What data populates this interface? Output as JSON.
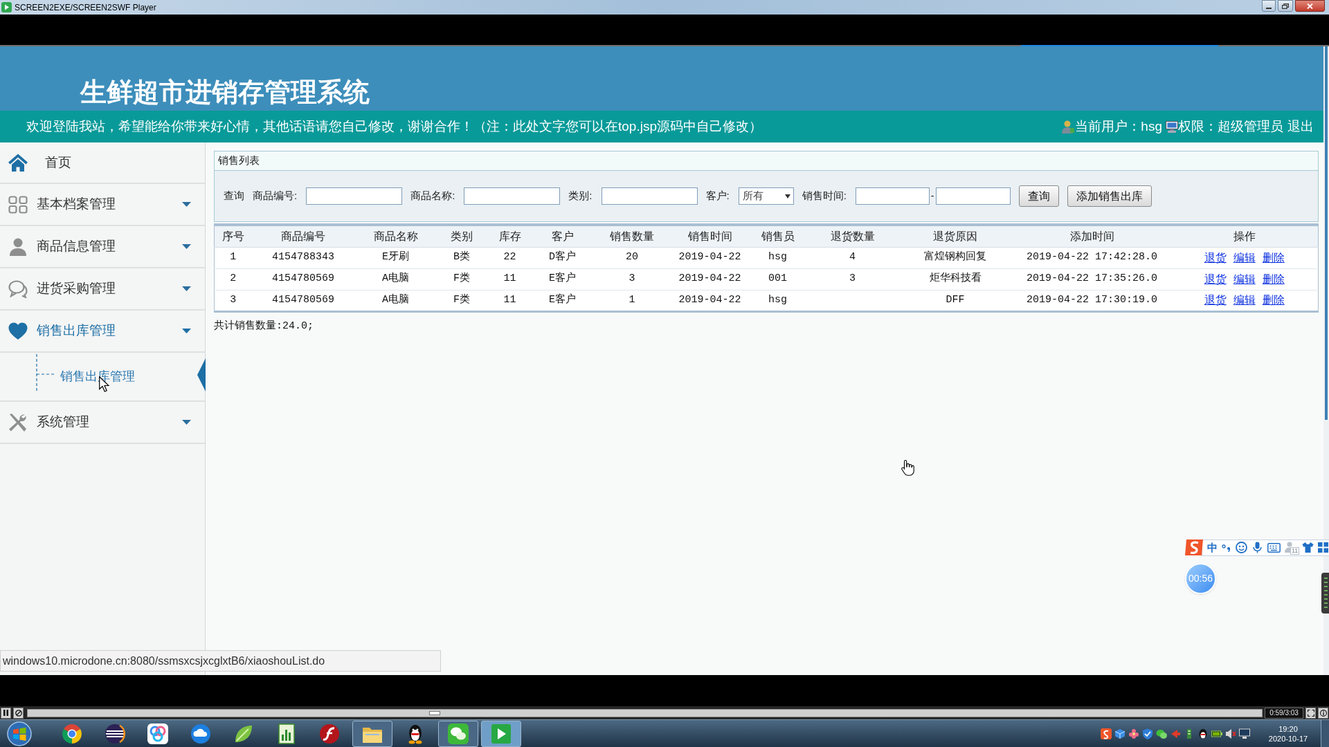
{
  "player_window": {
    "title": "SCREEN2EXE/SCREEN2SWF Player"
  },
  "header": {
    "title": "生鲜超市进销存管理系统"
  },
  "notice_bar": {
    "welcome": "欢迎登陆我站，希望能给你带来好心情，其他话语请您自己修改，谢谢合作！（注：此处文字您可以在top.jsp源码中自己修改）",
    "current_user": "当前用户：hsg",
    "role": "权限：超级管理员",
    "logout": "退出"
  },
  "sidebar": {
    "items": [
      {
        "label": "首页",
        "kind": "link",
        "selected": false
      },
      {
        "label": "基本档案管理",
        "kind": "group",
        "selected": false
      },
      {
        "label": "商品信息管理",
        "kind": "group",
        "selected": false
      },
      {
        "label": "进货采购管理",
        "kind": "group",
        "selected": false
      },
      {
        "label": "销售出库管理",
        "kind": "group",
        "selected": true,
        "children": [
          {
            "label": "销售出库管理",
            "selected": true
          }
        ]
      },
      {
        "label": "系统管理",
        "kind": "group",
        "selected": false
      }
    ]
  },
  "sales_list": {
    "title": "销售列表",
    "search": {
      "label": "查询",
      "fields": [
        {
          "label": "商品编号:",
          "kind": "text"
        },
        {
          "label": "商品名称:",
          "kind": "text"
        },
        {
          "label": "类别:",
          "kind": "text"
        },
        {
          "label": "客户:",
          "kind": "select",
          "value": "所有"
        },
        {
          "label": "销售时间:",
          "kind": "range",
          "separator": "-"
        }
      ],
      "buttons": [
        "查询",
        "添加销售出库"
      ]
    },
    "table": {
      "columns": [
        "序号",
        "商品编号",
        "商品名称",
        "类别",
        "库存",
        "客户",
        "销售数量",
        "销售时间",
        "销售员",
        "退货数量",
        "退货原因",
        "添加时间",
        "操作"
      ],
      "rows": [
        {
          "seq": "1",
          "code": "4154788343",
          "name": "E牙刷",
          "category": "B类",
          "stock": "22",
          "customer": "D客户",
          "quantity": "20",
          "sale_date": "2019-04-22",
          "seller": "hsg",
          "return_quantity": "4",
          "return_reason": "富煌钢构回复",
          "added_at": "2019-04-22 17:42:28.0",
          "actions": [
            "退货",
            "编辑",
            "删除"
          ]
        },
        {
          "seq": "2",
          "code": "4154780569",
          "name": "A电脑",
          "category": "F类",
          "stock": "11",
          "customer": "E客户",
          "quantity": "3",
          "sale_date": "2019-04-22",
          "seller": "001",
          "return_quantity": "3",
          "return_reason": "炬华科技看",
          "added_at": "2019-04-22 17:35:26.0",
          "actions": [
            "退货",
            "编辑",
            "删除"
          ]
        },
        {
          "seq": "3",
          "code": "4154780569",
          "name": "A电脑",
          "category": "F类",
          "stock": "11",
          "customer": "E客户",
          "quantity": "1",
          "sale_date": "2019-04-22",
          "seller": "hsg",
          "return_reason": "DFF",
          "added_at": "2019-04-22 17:30:19.0",
          "actions": [
            "退货",
            "编辑",
            "删除"
          ]
        }
      ]
    },
    "total": "共计销售数量:24.0;"
  },
  "browser_status": {
    "url": "windows10.microdone.cn:8080/ssmsxcsjxcglxtB6/xiaoshouList.do"
  },
  "ime_toolbar": {
    "mode": "中",
    "badge": "11"
  },
  "recording_timer": {
    "time": "00:56"
  },
  "player": {
    "level": 0.33,
    "time": "0:59/3:03"
  },
  "taskbar": {
    "apps": [
      {
        "open": false,
        "selected": false
      },
      {
        "open": false,
        "selected": false
      },
      {
        "open": false,
        "selected": false
      },
      {
        "open": false,
        "selected": false
      },
      {
        "open": false,
        "selected": false
      },
      {
        "open": false,
        "selected": false
      },
      {
        "open": false,
        "selected": false
      },
      {
        "open": true,
        "selected": false
      },
      {
        "open": false,
        "selected": false
      },
      {
        "open": true,
        "selected": false
      },
      {
        "open": true,
        "selected": true
      }
    ],
    "clock": {
      "time": "19:20",
      "date": "2020-10-17"
    }
  }
}
